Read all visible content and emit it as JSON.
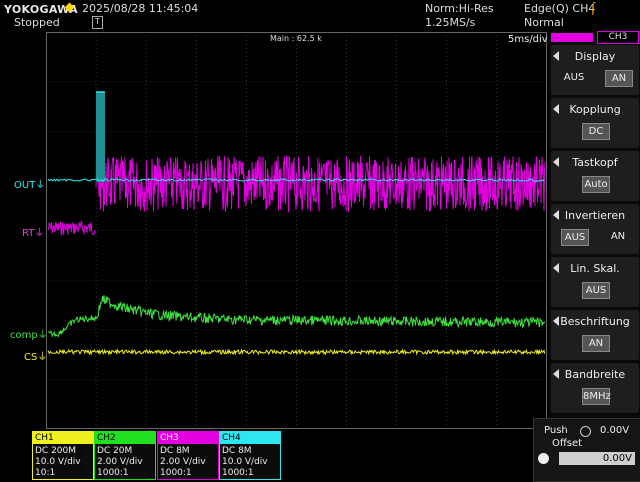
{
  "header": {
    "brand": "YOKOGAWA",
    "datetime": "2025/08/28 11:45:04",
    "status": "Stopped",
    "acq_mode": "Norm:Hi-Res",
    "sample_rate": "1.25MS/s",
    "trigger_type": "Edge(Q) CH4",
    "trigger_mode": "Normal",
    "trigger_pos_marker": "T"
  },
  "screen": {
    "main_label": "Main : 62.5 k",
    "time_div": "5ms/div",
    "labels": {
      "out": "OUT",
      "rt": "RT",
      "comp": "comp",
      "cs": "CS"
    },
    "colors": {
      "ch1": "#f0f020",
      "ch2": "#40e040",
      "ch3": "#e000e0",
      "ch4": "#2ee6f0",
      "grid": "#555555"
    }
  },
  "side_menu": {
    "channel_tab": "CH3",
    "sections": [
      {
        "title": "Display",
        "options": [
          "AUS",
          "AN"
        ],
        "selected": 1
      },
      {
        "title": "Kopplung",
        "options": [
          "DC"
        ],
        "selected": 0
      },
      {
        "title": "Tastkopf",
        "options": [
          "Auto"
        ],
        "selected": 0
      },
      {
        "title": "Invertieren",
        "options": [
          "AUS",
          "AN"
        ],
        "selected": 0
      },
      {
        "title": "Lin. Skal.",
        "options": [
          "AUS"
        ],
        "selected": 0
      },
      {
        "title": "Beschriftung",
        "options": [
          "AN"
        ],
        "selected": 0
      },
      {
        "title": "Bandbreite",
        "options": [
          "8MHz"
        ],
        "selected": 0
      }
    ],
    "push_offset": {
      "push": "Push",
      "offset": "Offset",
      "value": "0.00V",
      "field": "0.00V"
    }
  },
  "channels": [
    {
      "name": "CH1",
      "coupling": "DC 200M",
      "vdiv": "10.0 V/div",
      "probe": "10:1",
      "color": "#f0f020"
    },
    {
      "name": "CH2",
      "coupling": "DC 20M",
      "vdiv": "2.00 V/div",
      "probe": "1000:1",
      "color": "#20e020"
    },
    {
      "name": "CH3",
      "coupling": "DC 8M",
      "vdiv": "2.00 V/div",
      "probe": "1000:1",
      "color": "#e000e0"
    },
    {
      "name": "CH4",
      "coupling": "DC 8M",
      "vdiv": "10.0 V/div",
      "probe": "1000:1",
      "color": "#2ee6f0"
    }
  ]
}
